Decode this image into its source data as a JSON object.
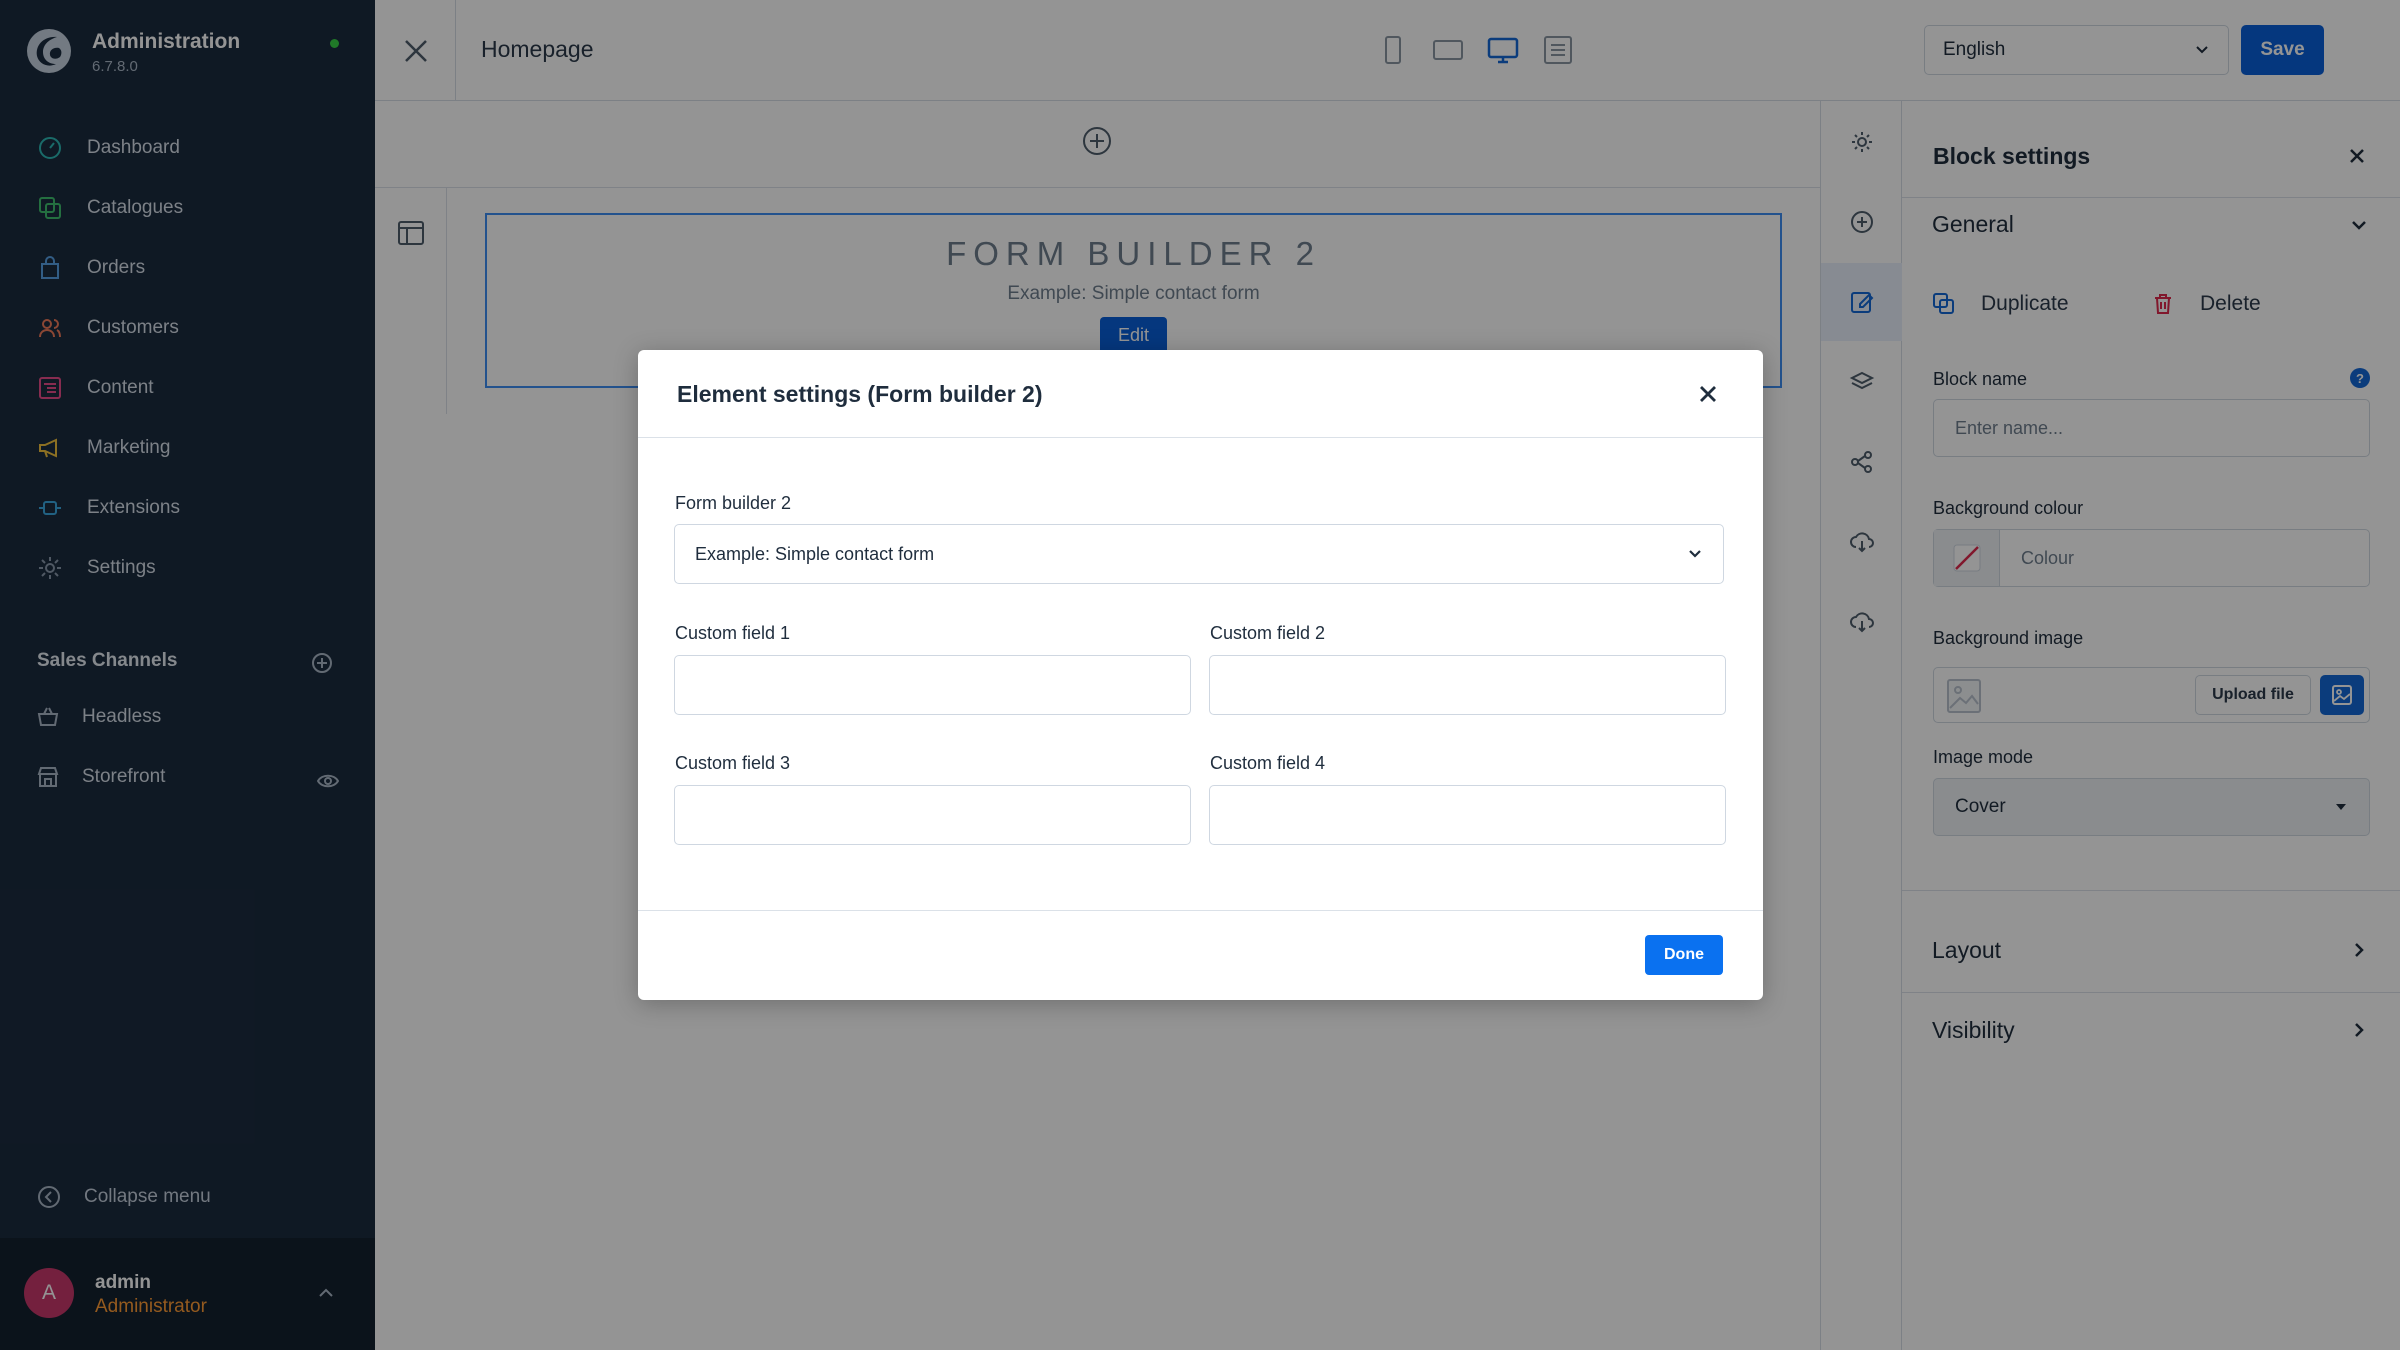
{
  "app": {
    "title": "Administration",
    "version": "6.7.8.0"
  },
  "sidebar": {
    "items": [
      {
        "label": "Dashboard",
        "icon": "dashboard-icon",
        "color": "#2db9b5"
      },
      {
        "label": "Catalogues",
        "icon": "catalogues-icon",
        "color": "#3fbf6f"
      },
      {
        "label": "Orders",
        "icon": "orders-icon",
        "color": "#57a0e5"
      },
      {
        "label": "Customers",
        "icon": "customers-icon",
        "color": "#f07a5a"
      },
      {
        "label": "Content",
        "icon": "content-icon",
        "color": "#e84d8a"
      },
      {
        "label": "Marketing",
        "icon": "marketing-icon",
        "color": "#f2c23d"
      },
      {
        "label": "Extensions",
        "icon": "extensions-icon",
        "color": "#3aa7e0"
      },
      {
        "label": "Settings",
        "icon": "settings-icon",
        "color": "#8a9aad"
      }
    ],
    "sales_channels": {
      "heading": "Sales Channels",
      "items": [
        {
          "label": "Headless",
          "icon": "basket-icon"
        },
        {
          "label": "Storefront",
          "icon": "storefront-icon"
        }
      ]
    },
    "collapse_label": "Collapse menu",
    "user": {
      "initial": "A",
      "name": "admin",
      "role": "Administrator"
    }
  },
  "topbar": {
    "title": "Homepage",
    "devices": [
      "mobile-device-icon",
      "tablet-device-icon",
      "desktop-device-icon",
      "list-view-icon"
    ],
    "language": "English",
    "save_label": "Save"
  },
  "canvas": {
    "block_title": "FORM BUILDER 2",
    "block_subtitle": "Example: Simple contact form",
    "edit_label": "Edit"
  },
  "right_toolbar": [
    "settings-icon",
    "add-block-icon",
    "edit-block-icon",
    "layers-icon",
    "share-icon",
    "cloud-download-icon",
    "cloud-download-icon"
  ],
  "panel": {
    "title": "Block settings",
    "general": "General",
    "duplicate": "Duplicate",
    "delete": "Delete",
    "block_name_label": "Block name",
    "block_name_placeholder": "Enter name...",
    "bg_colour_label": "Background colour",
    "colour_placeholder": "Colour",
    "bg_image_label": "Background image",
    "upload_label": "Upload file",
    "image_mode_label": "Image mode",
    "image_mode_value": "Cover",
    "layout": "Layout",
    "visibility": "Visibility"
  },
  "modal": {
    "title": "Element settings (Form builder 2)",
    "select_label": "Form builder 2",
    "select_value": "Example: Simple contact form",
    "fields": [
      {
        "label": "Custom field 1",
        "value": ""
      },
      {
        "label": "Custom field 2",
        "value": ""
      },
      {
        "label": "Custom field 3",
        "value": ""
      },
      {
        "label": "Custom field 4",
        "value": ""
      }
    ],
    "done_label": "Done"
  },
  "colors": {
    "accent": "#0a60d9",
    "sidebar_bg": "#1b2b3f",
    "role": "#ff9c36",
    "status_online": "#37d046"
  }
}
